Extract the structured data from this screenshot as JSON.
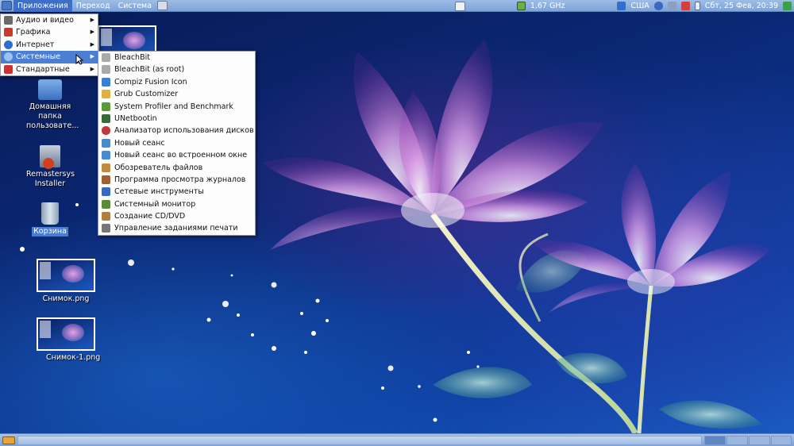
{
  "top_panel": {
    "menus": [
      "Приложения",
      "Переход",
      "Система"
    ],
    "cpu_freq": "1,67 GHz",
    "keyboard_layout": "США",
    "clock": "Сбт, 25 Фев, 20:39"
  },
  "apps_menu": {
    "items": [
      {
        "label": "Аудио и видео",
        "icon": "audio-video-icon",
        "color": "#6a6a6a"
      },
      {
        "label": "Графика",
        "icon": "graphics-icon",
        "color": "#c93a2a"
      },
      {
        "label": "Интернет",
        "icon": "internet-icon",
        "color": "#2a6fd0"
      },
      {
        "label": "Системные",
        "icon": "system-icon",
        "color": "#3a8ad8"
      },
      {
        "label": "Стандартные",
        "icon": "accessories-icon",
        "color": "#d03030"
      }
    ],
    "active_index": 3
  },
  "system_submenu": {
    "items": [
      {
        "label": "BleachBit",
        "icon": "bleachbit-icon",
        "color": "#888888"
      },
      {
        "label": "BleachBit (as root)",
        "icon": "bleachbit-root-icon",
        "color": "#888888"
      },
      {
        "label": "Compiz Fusion Icon",
        "icon": "compiz-icon",
        "color": "#3a7fd0"
      },
      {
        "label": "Grub Customizer",
        "icon": "grub-icon",
        "color": "#d0a030"
      },
      {
        "label": "System Profiler and Benchmark",
        "icon": "profiler-icon",
        "color": "#5a9a3a"
      },
      {
        "label": "UNetbootin",
        "icon": "unetbootin-icon",
        "color": "#3a6a3a"
      },
      {
        "label": "Анализатор использования дисков",
        "icon": "disk-usage-icon",
        "color": "#c03a3a"
      },
      {
        "label": "Новый сеанс",
        "icon": "new-session-icon",
        "color": "#4a8ad0"
      },
      {
        "label": "Новый сеанс во встроенном окне",
        "icon": "nested-session-icon",
        "color": "#4a8ad0"
      },
      {
        "label": "Обозреватель файлов",
        "icon": "file-browser-icon",
        "color": "#c08a40"
      },
      {
        "label": "Программа просмотра журналов",
        "icon": "log-viewer-icon",
        "color": "#a06030"
      },
      {
        "label": "Сетевые инструменты",
        "icon": "network-tools-icon",
        "color": "#3a6ac0"
      },
      {
        "label": "Системный монитор",
        "icon": "system-monitor-icon",
        "color": "#5a8a3a"
      },
      {
        "label": "Создание CD/DVD",
        "icon": "cd-burner-icon",
        "color": "#b08040"
      },
      {
        "label": "Управление заданиями печати",
        "icon": "print-queue-icon",
        "color": "#777777"
      }
    ]
  },
  "desktop": {
    "icons": [
      {
        "label": "Домашняя папка пользовате...",
        "icon": "home-folder-icon"
      },
      {
        "label": "Remastersys Installer",
        "icon": "installer-icon"
      },
      {
        "label": "Корзина",
        "icon": "trash-icon"
      },
      {
        "label": "Снимок.png",
        "icon": "image-thumbnail"
      },
      {
        "label": "Снимок-1.png",
        "icon": "image-thumbnail"
      }
    ]
  }
}
